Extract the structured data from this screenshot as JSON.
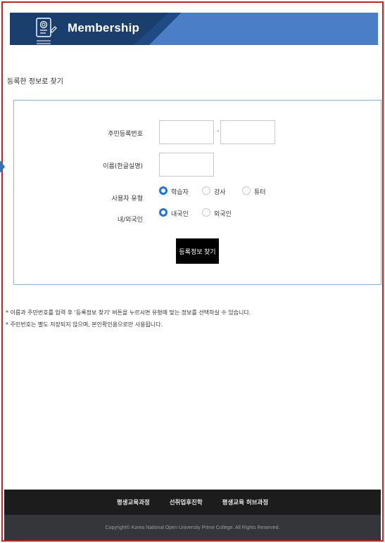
{
  "header": {
    "title": "Membership",
    "icon": "certificate-icon"
  },
  "section_title": "등록한 정보로 찾기",
  "form": {
    "rrn_label": "주민등록번호",
    "rrn_first": "",
    "rrn_dash": "-",
    "rrn_second": "",
    "name_label": "이름(한글실명)",
    "name_value": "",
    "user_type_label": "사용자 유형",
    "user_types": [
      "학습자",
      "강사",
      "튜터"
    ],
    "user_type_selected": "학습자",
    "nationality_label": "내/외국인",
    "nationalities": [
      "내국인",
      "외국인"
    ],
    "nationality_selected": "내국인",
    "find_button": "등록정보 찾기"
  },
  "notes": [
    "* 이름과 주민번호를 입력 후 '등록정보 찾기' 버튼을 누르시면 유형에 맞는 정보를 선택하실 수 있습니다.",
    "* 주민번호는 별도 저장되지 않으며, 본인확인용으로만 사용됩니다."
  ],
  "footer": {
    "links": [
      "평생교육과정",
      "선취업후진학",
      "평생교육 허브과정"
    ],
    "copyright": "Copyright© Korea National Open University Prime College. All Rights Reserved."
  },
  "colors": {
    "accent_red": "#e01a1a",
    "header_blue": "#1e4b85",
    "radio_blue": "#1f76d6"
  }
}
